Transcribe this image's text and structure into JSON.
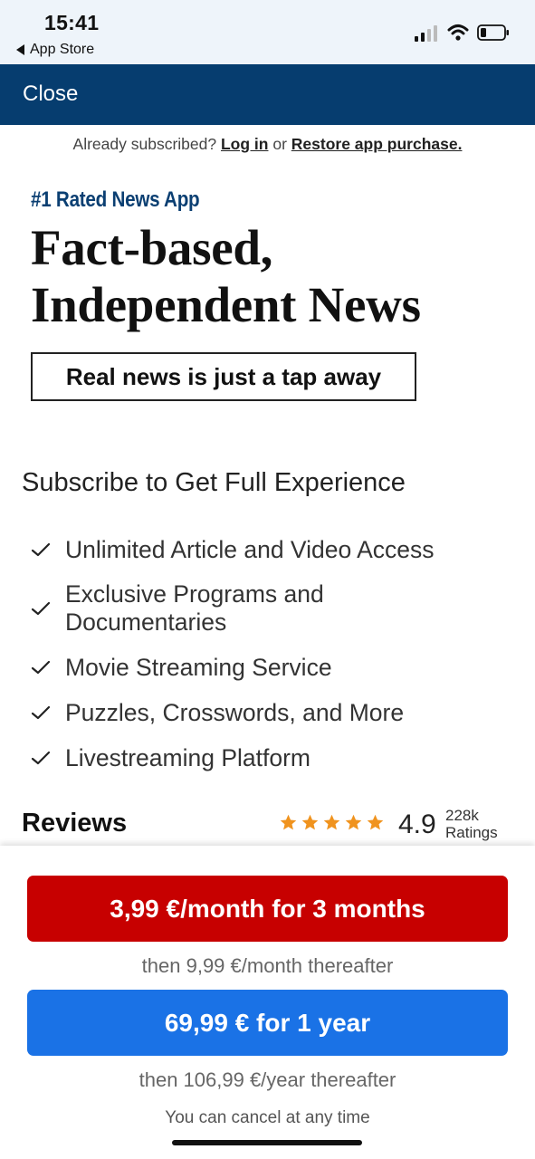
{
  "status_bar": {
    "time": "15:41",
    "back_app": "App Store"
  },
  "nav": {
    "close_label": "Close"
  },
  "login_line": {
    "prefix": "Already subscribed?",
    "login_label": "Log in",
    "or": "or",
    "restore_label": "Restore app purchase."
  },
  "hero": {
    "badge": "#1 Rated News App",
    "headline_line1": "Fact-based,",
    "headline_line2": "Independent News",
    "tagline": "Real news is just a tap away"
  },
  "subscribe": {
    "title": "Subscribe to Get Full Experience",
    "features": [
      {
        "line1": "Unlimited Article and Video Access",
        "line2": ""
      },
      {
        "line1": "Exclusive Programs and",
        "line2": "Documentaries"
      },
      {
        "line1": "Movie Streaming Service",
        "line2": ""
      },
      {
        "line1": "Puzzles, Crosswords, and More",
        "line2": ""
      },
      {
        "line1": "Livestreaming Platform",
        "line2": ""
      }
    ]
  },
  "reviews": {
    "title": "Reviews",
    "stars": 5,
    "rating": "4.9",
    "count_line1": "228k",
    "count_line2": "Ratings"
  },
  "offers": {
    "monthly_label": "3,99 €/month for 3 months",
    "monthly_then": "then 9,99 €/month thereafter",
    "yearly_label": "69,99 € for 1 year",
    "yearly_then": "then 106,99 €/year thereafter",
    "cancel_note": "You can cancel at any time"
  },
  "colors": {
    "nav_bg": "#063d6f",
    "badge_text": "#0b3f72",
    "monthly_button": "#c70000",
    "yearly_button": "#1a72e6",
    "star": "#f0931e"
  }
}
